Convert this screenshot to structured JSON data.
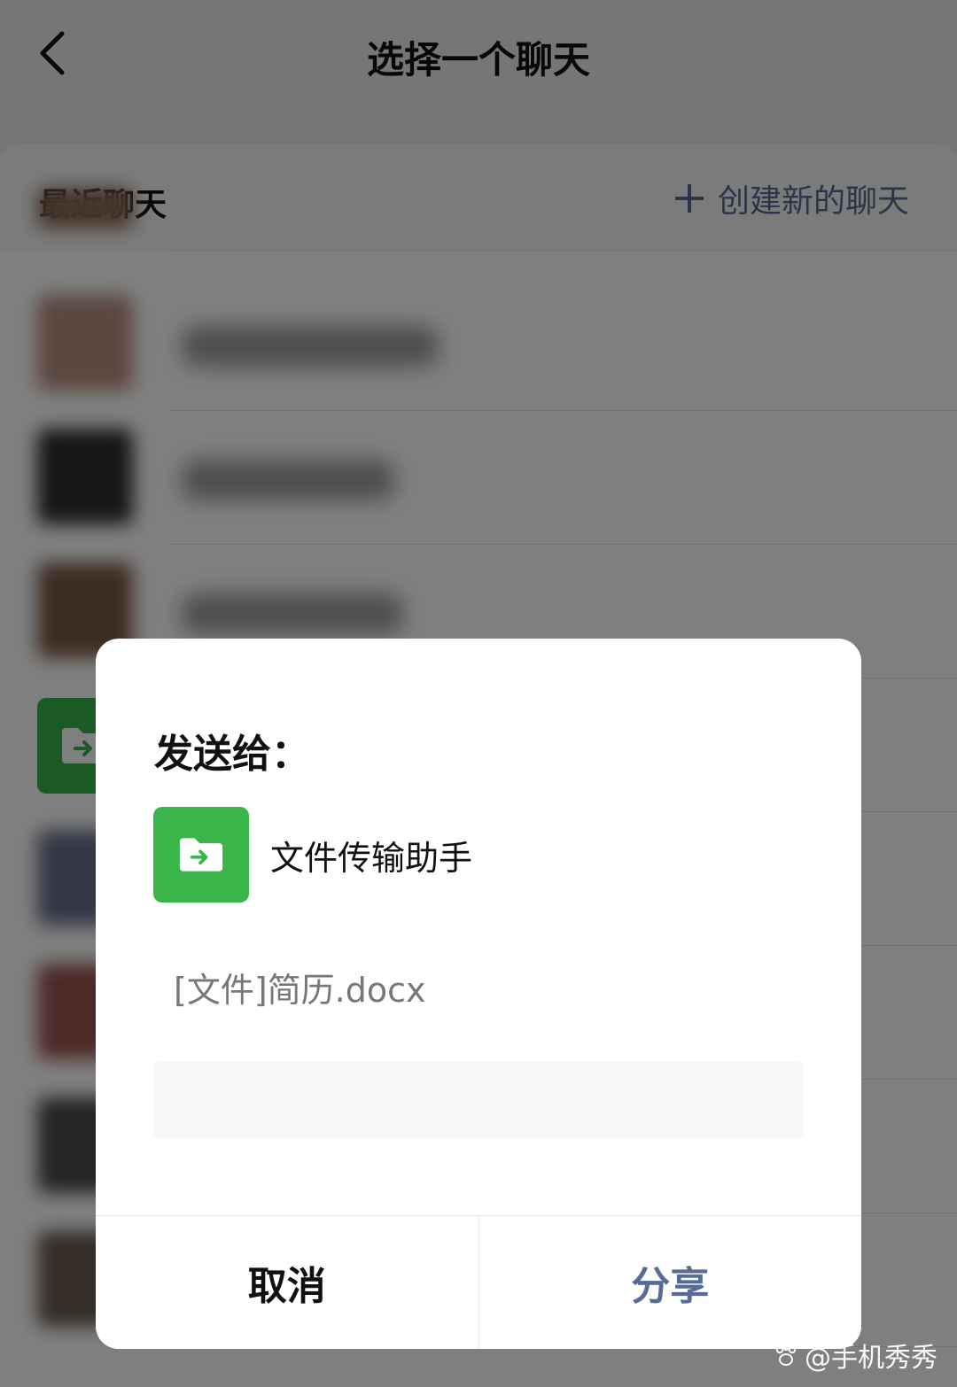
{
  "header": {
    "title": "选择一个聊天"
  },
  "section": {
    "title": "最近聊天",
    "create_label": "创建新的聊天"
  },
  "dialog": {
    "title": "发送给：",
    "recipient_name": "文件传输助手",
    "file_info": "[文件]简历.docx",
    "input_value": "",
    "cancel_label": "取消",
    "share_label": "分享"
  },
  "watermark": {
    "text": "@手机秀秀"
  },
  "colors": {
    "accent": "#576b95",
    "file_helper_green": "#39b54a",
    "overlay": "#000000"
  },
  "icons": {
    "back": "chevron-left-icon",
    "plus": "plus-icon",
    "file_transfer": "folder-arrow-icon"
  }
}
